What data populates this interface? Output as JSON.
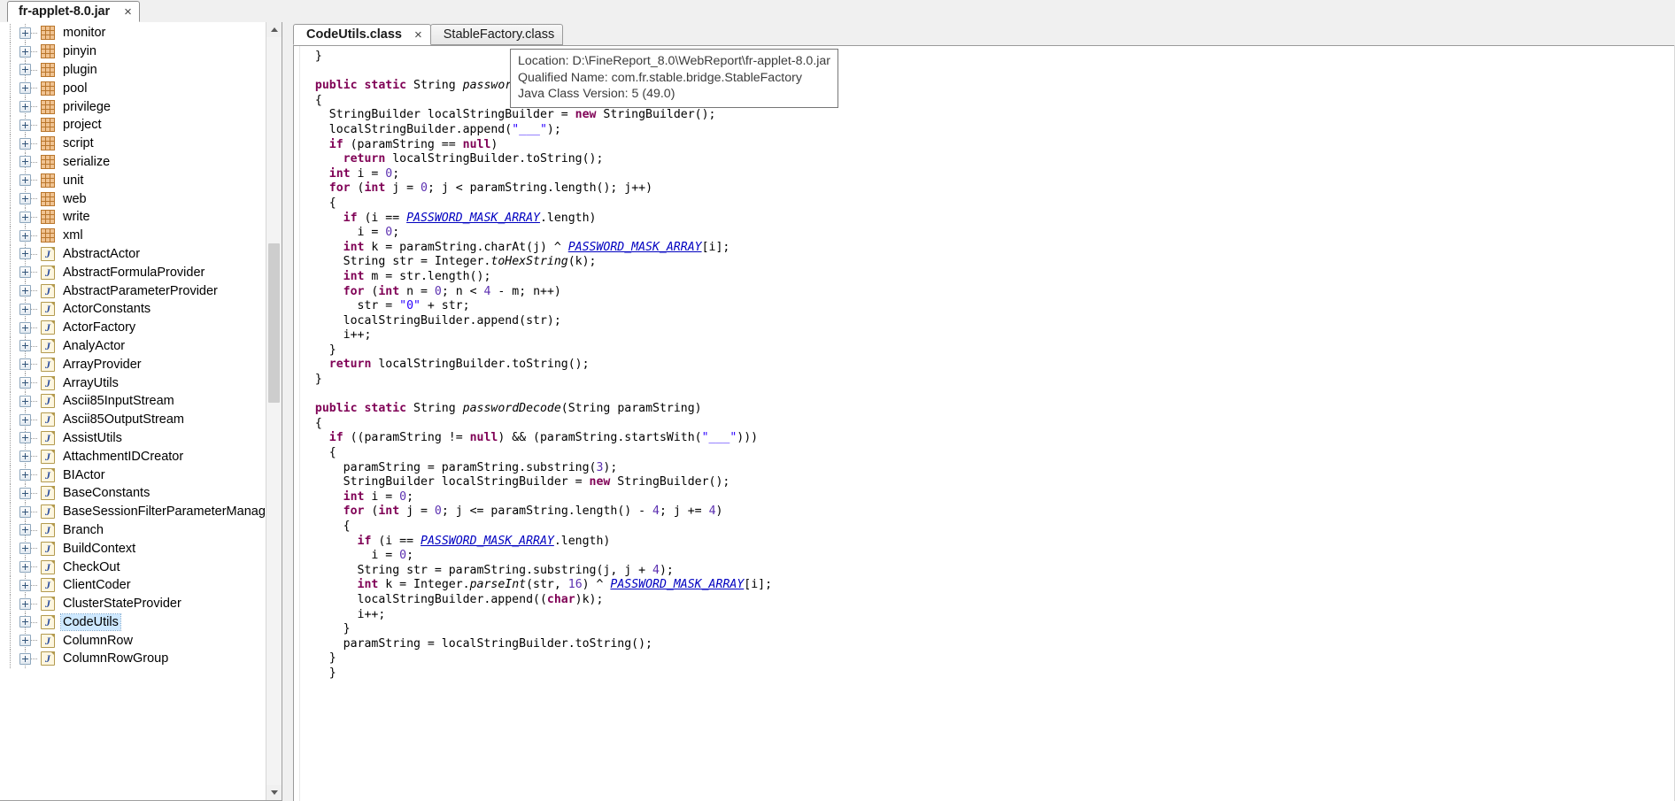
{
  "window": {
    "jar_tab": {
      "label": "fr-applet-8.0.jar",
      "close_icon": "×"
    }
  },
  "tree": {
    "scrollbar": {
      "up_icon": "chevron-up-icon",
      "down_icon": "chevron-down-icon"
    },
    "items": [
      {
        "label": "monitor",
        "type": "package"
      },
      {
        "label": "pinyin",
        "type": "package"
      },
      {
        "label": "plugin",
        "type": "package"
      },
      {
        "label": "pool",
        "type": "package"
      },
      {
        "label": "privilege",
        "type": "package"
      },
      {
        "label": "project",
        "type": "package"
      },
      {
        "label": "script",
        "type": "package"
      },
      {
        "label": "serialize",
        "type": "package"
      },
      {
        "label": "unit",
        "type": "package"
      },
      {
        "label": "web",
        "type": "package"
      },
      {
        "label": "write",
        "type": "package"
      },
      {
        "label": "xml",
        "type": "package"
      },
      {
        "label": "AbstractActor",
        "type": "class"
      },
      {
        "label": "AbstractFormulaProvider",
        "type": "class"
      },
      {
        "label": "AbstractParameterProvider",
        "type": "class"
      },
      {
        "label": "ActorConstants",
        "type": "class"
      },
      {
        "label": "ActorFactory",
        "type": "class"
      },
      {
        "label": "AnalyActor",
        "type": "class"
      },
      {
        "label": "ArrayProvider",
        "type": "class"
      },
      {
        "label": "ArrayUtils",
        "type": "class"
      },
      {
        "label": "Ascii85InputStream",
        "type": "class"
      },
      {
        "label": "Ascii85OutputStream",
        "type": "class"
      },
      {
        "label": "AssistUtils",
        "type": "class"
      },
      {
        "label": "AttachmentIDCreator",
        "type": "class"
      },
      {
        "label": "BIActor",
        "type": "class"
      },
      {
        "label": "BaseConstants",
        "type": "class"
      },
      {
        "label": "BaseSessionFilterParameterManag",
        "type": "class"
      },
      {
        "label": "Branch",
        "type": "class"
      },
      {
        "label": "BuildContext",
        "type": "class"
      },
      {
        "label": "CheckOut",
        "type": "class"
      },
      {
        "label": "ClientCoder",
        "type": "class"
      },
      {
        "label": "ClusterStateProvider",
        "type": "class"
      },
      {
        "label": "CodeUtils",
        "type": "class",
        "selected": true
      },
      {
        "label": "ColumnRow",
        "type": "class"
      },
      {
        "label": "ColumnRowGroup",
        "type": "class"
      }
    ]
  },
  "editor": {
    "tabs": [
      {
        "label": "CodeUtils.class",
        "active": true,
        "close_icon": "×"
      },
      {
        "label": "StableFactory.class",
        "active": false
      }
    ],
    "code_lines": [
      [
        {
          "t": "  }",
          "c": ""
        }
      ],
      [
        {
          "t": "",
          "c": ""
        }
      ],
      [
        {
          "t": "  ",
          "c": ""
        },
        {
          "t": "public static",
          "c": "kw"
        },
        {
          "t": " String ",
          "c": ""
        },
        {
          "t": "passwordEncode",
          "c": "mth"
        },
        {
          "t": "(String paramString)",
          "c": ""
        }
      ],
      [
        {
          "t": "  {",
          "c": ""
        }
      ],
      [
        {
          "t": "    StringBuilder localStringBuilder = ",
          "c": ""
        },
        {
          "t": "new",
          "c": "kw"
        },
        {
          "t": " StringBuilder();",
          "c": ""
        }
      ],
      [
        {
          "t": "    localStringBuilder.append(",
          "c": ""
        },
        {
          "t": "\"___\"",
          "c": "str"
        },
        {
          "t": ");",
          "c": ""
        }
      ],
      [
        {
          "t": "    ",
          "c": ""
        },
        {
          "t": "if",
          "c": "kw"
        },
        {
          "t": " (paramString == ",
          "c": ""
        },
        {
          "t": "null",
          "c": "kw"
        },
        {
          "t": ")",
          "c": ""
        }
      ],
      [
        {
          "t": "      ",
          "c": ""
        },
        {
          "t": "return",
          "c": "kw"
        },
        {
          "t": " localStringBuilder.toString();",
          "c": ""
        }
      ],
      [
        {
          "t": "    ",
          "c": ""
        },
        {
          "t": "int",
          "c": "kw"
        },
        {
          "t": " i = ",
          "c": ""
        },
        {
          "t": "0",
          "c": "num"
        },
        {
          "t": ";",
          "c": ""
        }
      ],
      [
        {
          "t": "    ",
          "c": ""
        },
        {
          "t": "for",
          "c": "kw"
        },
        {
          "t": " (",
          "c": ""
        },
        {
          "t": "int",
          "c": "kw"
        },
        {
          "t": " j = ",
          "c": ""
        },
        {
          "t": "0",
          "c": "num"
        },
        {
          "t": "; j < paramString.length(); j++)",
          "c": ""
        }
      ],
      [
        {
          "t": "    {",
          "c": ""
        }
      ],
      [
        {
          "t": "      ",
          "c": ""
        },
        {
          "t": "if",
          "c": "kw"
        },
        {
          "t": " (i == ",
          "c": ""
        },
        {
          "t": "PASSWORD_MASK_ARRAY",
          "c": "fld"
        },
        {
          "t": ".length)",
          "c": ""
        }
      ],
      [
        {
          "t": "        i = ",
          "c": ""
        },
        {
          "t": "0",
          "c": "num"
        },
        {
          "t": ";",
          "c": ""
        }
      ],
      [
        {
          "t": "      ",
          "c": ""
        },
        {
          "t": "int",
          "c": "kw"
        },
        {
          "t": " k = paramString.charAt(j) ^ ",
          "c": ""
        },
        {
          "t": "PASSWORD_MASK_ARRAY",
          "c": "fld"
        },
        {
          "t": "[i];",
          "c": ""
        }
      ],
      [
        {
          "t": "      String str = Integer.",
          "c": ""
        },
        {
          "t": "toHexString",
          "c": "mth"
        },
        {
          "t": "(k);",
          "c": ""
        }
      ],
      [
        {
          "t": "      ",
          "c": ""
        },
        {
          "t": "int",
          "c": "kw"
        },
        {
          "t": " m = str.length();",
          "c": ""
        }
      ],
      [
        {
          "t": "      ",
          "c": ""
        },
        {
          "t": "for",
          "c": "kw"
        },
        {
          "t": " (",
          "c": ""
        },
        {
          "t": "int",
          "c": "kw"
        },
        {
          "t": " n = ",
          "c": ""
        },
        {
          "t": "0",
          "c": "num"
        },
        {
          "t": "; n < ",
          "c": ""
        },
        {
          "t": "4",
          "c": "num"
        },
        {
          "t": " - m; n++)",
          "c": ""
        }
      ],
      [
        {
          "t": "        str = ",
          "c": ""
        },
        {
          "t": "\"0\"",
          "c": "str"
        },
        {
          "t": " + str;",
          "c": ""
        }
      ],
      [
        {
          "t": "      localStringBuilder.append(str);",
          "c": ""
        }
      ],
      [
        {
          "t": "      i++;",
          "c": ""
        }
      ],
      [
        {
          "t": "    }",
          "c": ""
        }
      ],
      [
        {
          "t": "    ",
          "c": ""
        },
        {
          "t": "return",
          "c": "kw"
        },
        {
          "t": " localStringBuilder.toString();",
          "c": ""
        }
      ],
      [
        {
          "t": "  }",
          "c": ""
        }
      ],
      [
        {
          "t": "",
          "c": ""
        }
      ],
      [
        {
          "t": "  ",
          "c": ""
        },
        {
          "t": "public static",
          "c": "kw"
        },
        {
          "t": " String ",
          "c": ""
        },
        {
          "t": "passwordDecode",
          "c": "mth"
        },
        {
          "t": "(String paramString)",
          "c": ""
        }
      ],
      [
        {
          "t": "  {",
          "c": ""
        }
      ],
      [
        {
          "t": "    ",
          "c": ""
        },
        {
          "t": "if",
          "c": "kw"
        },
        {
          "t": " ((paramString != ",
          "c": ""
        },
        {
          "t": "null",
          "c": "kw"
        },
        {
          "t": ") && (paramString.startsWith(",
          "c": ""
        },
        {
          "t": "\"___\"",
          "c": "str"
        },
        {
          "t": ")))",
          "c": ""
        }
      ],
      [
        {
          "t": "    {",
          "c": ""
        }
      ],
      [
        {
          "t": "      paramString = paramString.substring(",
          "c": ""
        },
        {
          "t": "3",
          "c": "num"
        },
        {
          "t": ");",
          "c": ""
        }
      ],
      [
        {
          "t": "      StringBuilder localStringBuilder = ",
          "c": ""
        },
        {
          "t": "new",
          "c": "kw"
        },
        {
          "t": " StringBuilder();",
          "c": ""
        }
      ],
      [
        {
          "t": "      ",
          "c": ""
        },
        {
          "t": "int",
          "c": "kw"
        },
        {
          "t": " i = ",
          "c": ""
        },
        {
          "t": "0",
          "c": "num"
        },
        {
          "t": ";",
          "c": ""
        }
      ],
      [
        {
          "t": "      ",
          "c": ""
        },
        {
          "t": "for",
          "c": "kw"
        },
        {
          "t": " (",
          "c": ""
        },
        {
          "t": "int",
          "c": "kw"
        },
        {
          "t": " j = ",
          "c": ""
        },
        {
          "t": "0",
          "c": "num"
        },
        {
          "t": "; j <= paramString.length() - ",
          "c": ""
        },
        {
          "t": "4",
          "c": "num"
        },
        {
          "t": "; j += ",
          "c": ""
        },
        {
          "t": "4",
          "c": "num"
        },
        {
          "t": ")",
          "c": ""
        }
      ],
      [
        {
          "t": "      {",
          "c": ""
        }
      ],
      [
        {
          "t": "        ",
          "c": ""
        },
        {
          "t": "if",
          "c": "kw"
        },
        {
          "t": " (i == ",
          "c": ""
        },
        {
          "t": "PASSWORD_MASK_ARRAY",
          "c": "fld"
        },
        {
          "t": ".length)",
          "c": ""
        }
      ],
      [
        {
          "t": "          i = ",
          "c": ""
        },
        {
          "t": "0",
          "c": "num"
        },
        {
          "t": ";",
          "c": ""
        }
      ],
      [
        {
          "t": "        String str = paramString.substring(j, j + ",
          "c": ""
        },
        {
          "t": "4",
          "c": "num"
        },
        {
          "t": ");",
          "c": ""
        }
      ],
      [
        {
          "t": "        ",
          "c": ""
        },
        {
          "t": "int",
          "c": "kw"
        },
        {
          "t": " k = Integer.",
          "c": ""
        },
        {
          "t": "parseInt",
          "c": "mth"
        },
        {
          "t": "(str, ",
          "c": ""
        },
        {
          "t": "16",
          "c": "num"
        },
        {
          "t": ") ^ ",
          "c": ""
        },
        {
          "t": "PASSWORD_MASK_ARRAY",
          "c": "fld"
        },
        {
          "t": "[i];",
          "c": ""
        }
      ],
      [
        {
          "t": "        localStringBuilder.append((",
          "c": ""
        },
        {
          "t": "char",
          "c": "kw"
        },
        {
          "t": ")k);",
          "c": ""
        }
      ],
      [
        {
          "t": "        i++;",
          "c": ""
        }
      ],
      [
        {
          "t": "      }",
          "c": ""
        }
      ],
      [
        {
          "t": "      paramString = localStringBuilder.toString();",
          "c": ""
        }
      ],
      [
        {
          "t": "    }",
          "c": ""
        }
      ],
      [
        {
          "t": "    }",
          "c": ""
        }
      ]
    ]
  },
  "tooltip": {
    "location_line": "Location: D:\\FineReport_8.0\\WebReport\\fr-applet-8.0.jar",
    "qualified_name_line": "Qualified Name: com.fr.stable.bridge.StableFactory",
    "class_version_line": "Java Class Version: 5 (49.0)"
  },
  "colors": {
    "keyword": "#7f0055",
    "string": "#2a00ff",
    "number": "#5b2fb0",
    "field": "#0000c0",
    "selection": "#cde8ff",
    "package_icon": "#f0c392",
    "class_icon": "#fdf6e0"
  }
}
